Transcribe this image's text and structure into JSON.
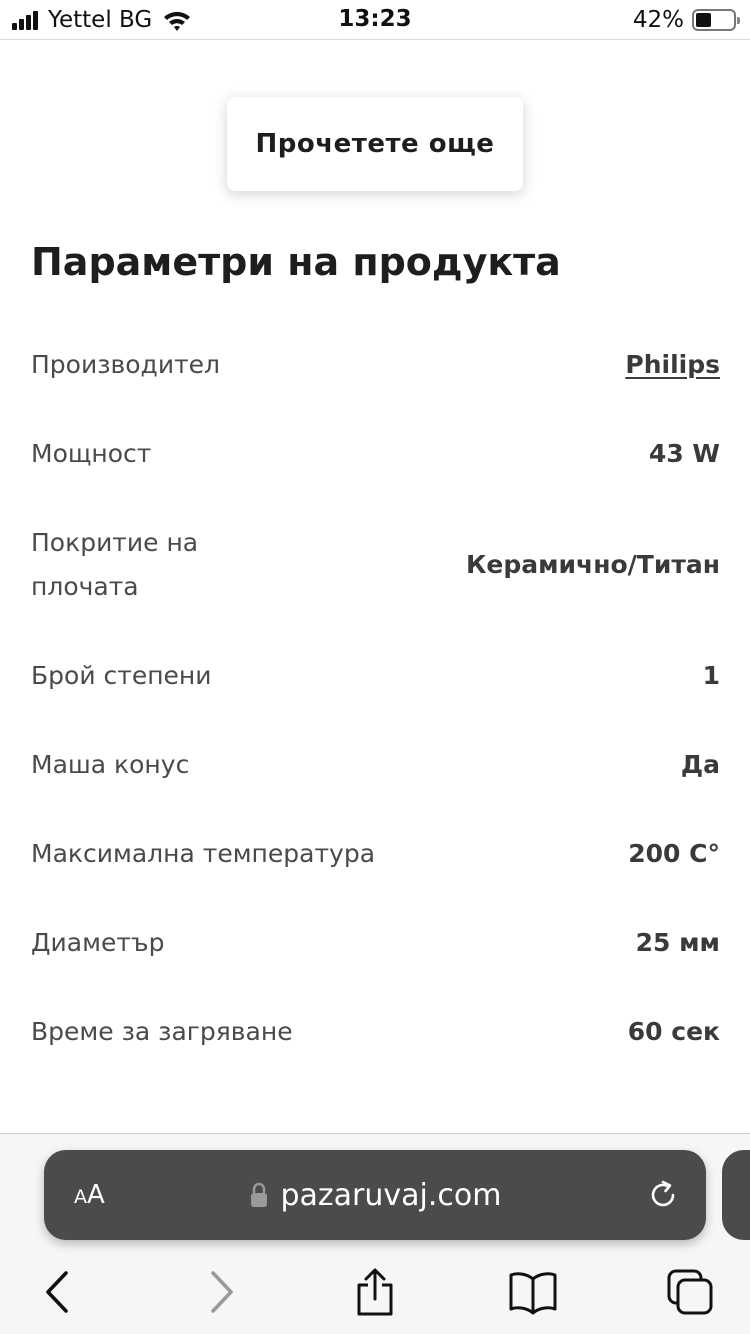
{
  "status_bar": {
    "carrier": "Yettel BG",
    "time": "13:23",
    "battery_percent": "42%",
    "battery_level": 0.42,
    "icons": [
      "signal-icon",
      "wifi-icon",
      "battery-icon"
    ]
  },
  "read_more_label": "Прочетете още",
  "section_title": "Параметри на продукта",
  "params": [
    {
      "label": "Производител",
      "value": "Philips",
      "link": true
    },
    {
      "label": "Мощност",
      "value": "43 W"
    },
    {
      "label": "Покритие на плочата",
      "value": "Керамично/Титан"
    },
    {
      "label": "Брой степени",
      "value": "1"
    },
    {
      "label": "Маша конус",
      "value": "Да"
    },
    {
      "label": "Максимална температура",
      "value": "200 C°"
    },
    {
      "label": "Диаметър",
      "value": "25 мм"
    },
    {
      "label": "Време за загряване",
      "value": "60 сек"
    }
  ],
  "browser": {
    "text_size_label": "AA",
    "url": "pazaruvaj.com",
    "icons": [
      "lock-icon",
      "reload-icon",
      "back-icon",
      "forward-icon",
      "share-icon",
      "bookmarks-icon",
      "tabs-icon"
    ]
  },
  "colors": {
    "url_bar": "#4b4b4b",
    "toolbar_background": "#f6f6f6",
    "text_dark": "#1e1e1e"
  }
}
